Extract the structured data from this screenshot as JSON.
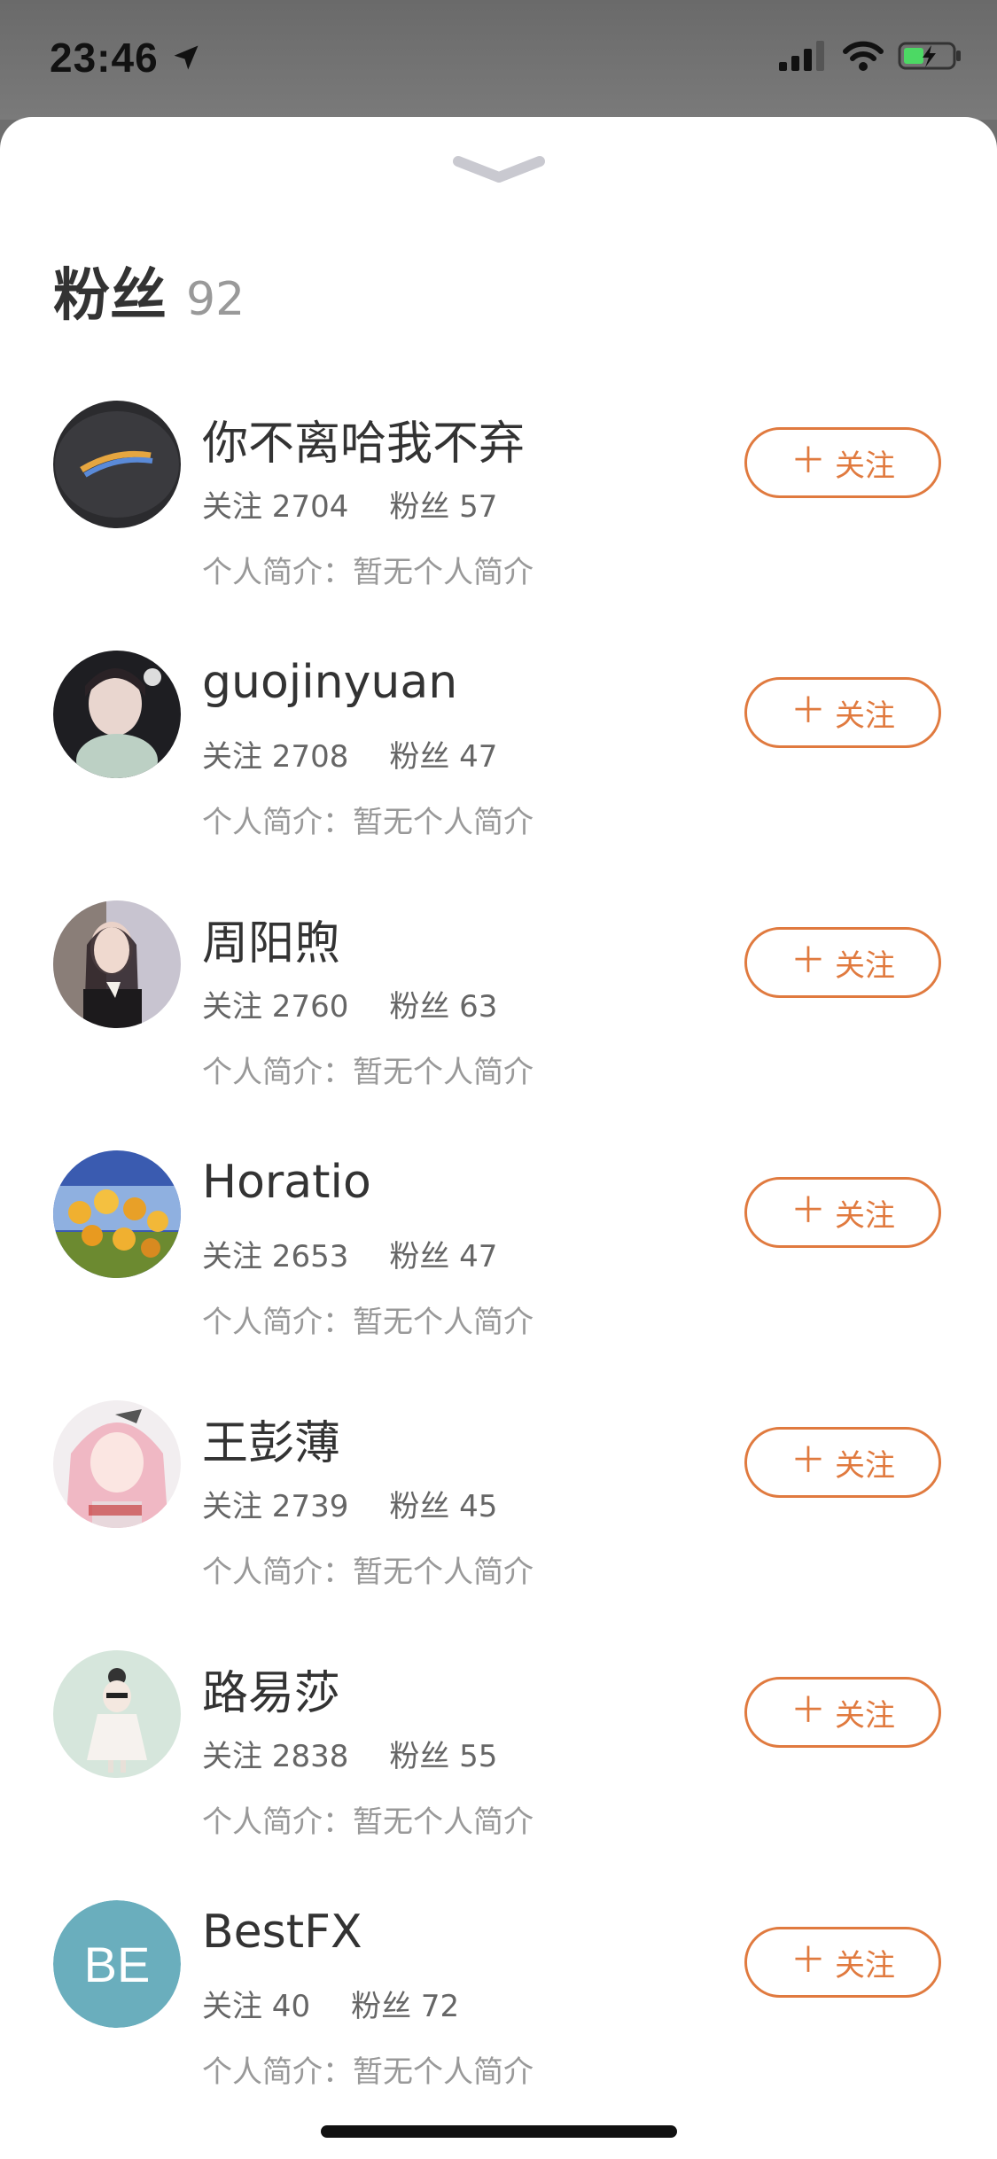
{
  "status_bar": {
    "time": "23:46",
    "icons": [
      "location-arrow-icon",
      "signal-icon",
      "wifi-icon",
      "battery-charging-icon"
    ]
  },
  "sheet": {
    "handle_icon": "chevron-down-icon",
    "title": "粉丝",
    "count": "92"
  },
  "followers": [
    {
      "name": "你不离哈我不弃",
      "following": "关注 2704",
      "fans": "粉丝 57",
      "bio": "个人简介：暂无个人简介",
      "button": "关注",
      "avatar": "photo"
    },
    {
      "name": "guojinyuan",
      "following": "关注 2708",
      "fans": "粉丝 47",
      "bio": "个人简介：暂无个人简介",
      "button": "关注",
      "avatar": "photo"
    },
    {
      "name": "周阳煦",
      "following": "关注 2760",
      "fans": "粉丝 63",
      "bio": "个人简介：暂无个人简介",
      "button": "关注",
      "avatar": "photo"
    },
    {
      "name": "Horatio",
      "following": "关注 2653",
      "fans": "粉丝 47",
      "bio": "个人简介：暂无个人简介",
      "button": "关注",
      "avatar": "photo"
    },
    {
      "name": "王彭薄",
      "following": "关注 2739",
      "fans": "粉丝 45",
      "bio": "个人简介：暂无个人简介",
      "button": "关注",
      "avatar": "photo"
    },
    {
      "name": "路易莎",
      "following": "关注 2838",
      "fans": "粉丝 55",
      "bio": "个人简介：暂无个人简介",
      "button": "关注",
      "avatar": "photo"
    },
    {
      "name": "BestFX",
      "following": "关注 40",
      "fans": "粉丝 72",
      "bio": "个人简介：暂无个人简介",
      "button": "关注",
      "avatar_initials": "BE"
    }
  ],
  "colors": {
    "accent": "#e07a3f",
    "initials_avatar_bg": "#6aaebd"
  }
}
